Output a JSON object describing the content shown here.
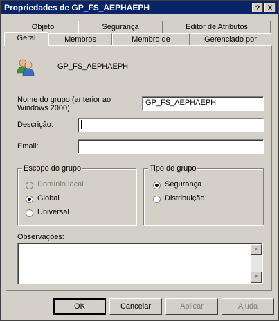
{
  "window": {
    "title": "Propriedades de GP_FS_AEPHAEPH",
    "help_btn": "?",
    "close_btn": "X"
  },
  "tabs_row1": [
    "Objeto",
    "Segurança",
    "Editor de Atributos"
  ],
  "tabs_row2": [
    "Geral",
    "Membros",
    "Membro de",
    "Gerenciado por"
  ],
  "group_name": "GP_FS_AEPHAEPH",
  "fields": {
    "pre2000_label": "Nome do grupo (anterior ao Windows 2000):",
    "pre2000_value": "GP_FS_AEPHAEPH",
    "description_label": "Descrição:",
    "description_value": "",
    "email_label": "Email:",
    "email_value": ""
  },
  "scope": {
    "title": "Escopo do grupo",
    "options": [
      "Domínio local",
      "Global",
      "Universal"
    ],
    "selected": "Global"
  },
  "type": {
    "title": "Tipo de grupo",
    "options": [
      "Segurança",
      "Distribuição"
    ],
    "selected": "Segurança"
  },
  "notes": {
    "label": "Observações:",
    "value": ""
  },
  "buttons": {
    "ok": "OK",
    "cancel": "Cancelar",
    "apply": "Aplicar",
    "help": "Ajuda"
  }
}
